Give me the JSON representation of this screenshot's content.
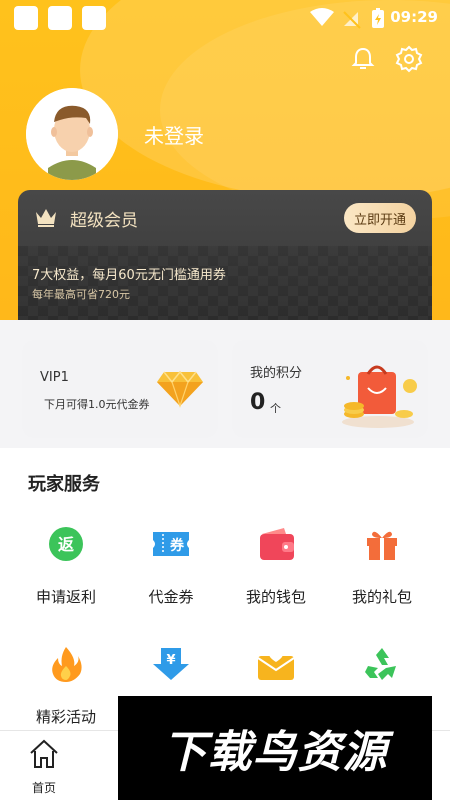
{
  "status_bar": {
    "time": "09:29"
  },
  "profile": {
    "login_status": "未登录"
  },
  "vip_card": {
    "title": "超级会员",
    "button": "立即开通",
    "benefits": "7大权益，每月60元无门槛通用券",
    "savings": "每年最高可省720元"
  },
  "vip_level": {
    "level": "VIP1",
    "next_reward": "下月可得1.0元代金券"
  },
  "points": {
    "label": "我的积分",
    "value": "0",
    "unit": "个"
  },
  "services": {
    "title": "玩家服务",
    "items": [
      {
        "label": "申请返利",
        "icon": "rebate-icon"
      },
      {
        "label": "代金券",
        "icon": "voucher-icon"
      },
      {
        "label": "我的钱包",
        "icon": "wallet-icon"
      },
      {
        "label": "我的礼包",
        "icon": "gift-icon"
      },
      {
        "label": "精彩活动",
        "icon": "flame-icon"
      },
      {
        "label": "",
        "icon": "yuan-download-icon"
      },
      {
        "label": "",
        "icon": "mail-heart-icon"
      },
      {
        "label": "",
        "icon": "recycle-icon"
      }
    ]
  },
  "bottom_nav": {
    "home_label": "首页"
  },
  "watermark": {
    "text": "下载鸟资源"
  },
  "colors": {
    "brand": "#ffb81a",
    "vip_card": "#2c2c2c",
    "gold": "#f3d2a0"
  }
}
